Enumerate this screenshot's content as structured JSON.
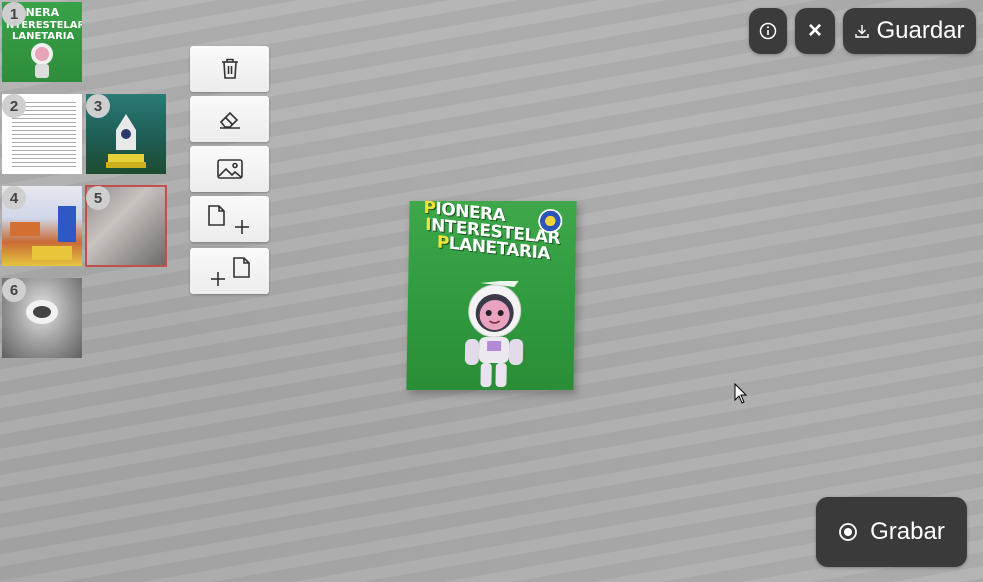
{
  "thumbnails": [
    {
      "number": "1",
      "kind": "cover"
    },
    {
      "number": "2",
      "kind": "text-page"
    },
    {
      "number": "3",
      "kind": "rocket"
    },
    {
      "number": "4",
      "kind": "photo-collage"
    },
    {
      "number": "5",
      "kind": "photo",
      "selected": true
    },
    {
      "number": "6",
      "kind": "photo"
    }
  ],
  "tools": [
    {
      "name": "delete-button",
      "icon": "trash-icon"
    },
    {
      "name": "erase-button",
      "icon": "eraser-icon"
    },
    {
      "name": "insert-image-button",
      "icon": "image-icon"
    },
    {
      "name": "add-page-after-button",
      "icon": "page-plus-icon"
    },
    {
      "name": "add-page-before-button",
      "icon": "plus-page-icon"
    }
  ],
  "header": {
    "info_icon": "info-icon",
    "close_icon": "close-icon",
    "close_label": "×",
    "save_label": "Guardar",
    "save_icon": "download-icon"
  },
  "book": {
    "title_line1_initial": "P",
    "title_line1_rest": "IONERA",
    "title_line2_initial": "I",
    "title_line2_rest": "NTERESTELAR",
    "title_line3_initial": "P",
    "title_line3_rest": "LANETARIA"
  },
  "record": {
    "label": "Grabar",
    "icon": "record-icon"
  },
  "colors": {
    "dark_button": "#3b3b3b",
    "selected_outline": "#c0504d",
    "cover_green": "#2f9a3e",
    "title_yellow": "#f2e53a"
  }
}
